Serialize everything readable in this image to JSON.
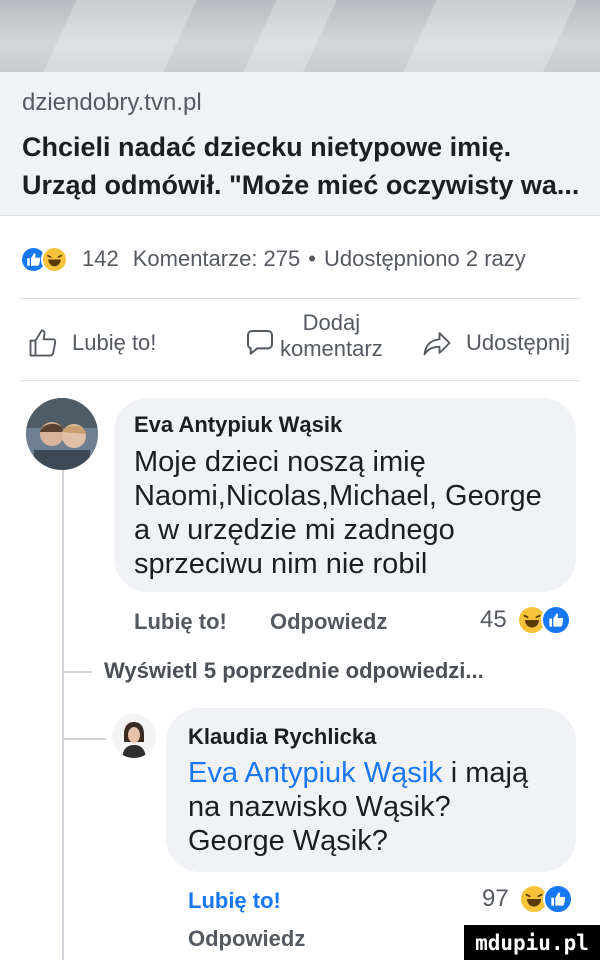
{
  "link_preview": {
    "domain": "dziendobry.tvn.pl",
    "headline": "Chcieli nadać dziecku nietypowe imię. Urząd odmówił. \"Może mieć oczywisty wa..."
  },
  "stats": {
    "reaction_count": "142",
    "comments": "Komentarze: 275",
    "dot": "•",
    "shares": "Udostępniono 2 razy"
  },
  "actions": {
    "like": "Lubię to!",
    "comment_line1": "Dodaj",
    "comment_line2": "komentarz",
    "share": "Udostępnij"
  },
  "comments": [
    {
      "author": "Eva Antypiuk Wąsik",
      "lines": [
        "Moje dzieci noszą imię",
        "Naomi,Nicolas,Michael, George",
        "a w urzędzie mi zadnego",
        "sprzeciwu nim nie robil"
      ],
      "like_label": "Lubię to!",
      "reply_label": "Odpowiedz",
      "reaction_count": "45"
    },
    {
      "author": "Klaudia Rychlicka",
      "mention": "Eva Antypiuk Wąsik",
      "line1_rest": " i mają",
      "lines": [
        "na nazwisko Wąsik?",
        "George Wąsik?"
      ],
      "like_label": "Lubię to!",
      "reply_label": "Odpowiedz",
      "reaction_count": "97"
    }
  ],
  "view_previous": "Wyświetl 5 poprzednie odpowiedzi...",
  "watermark": "mdupiu.pl",
  "colors": {
    "facebook_blue": "#1877f2",
    "haha_yellow": "#f7c33a",
    "muted_text": "#555a60"
  }
}
